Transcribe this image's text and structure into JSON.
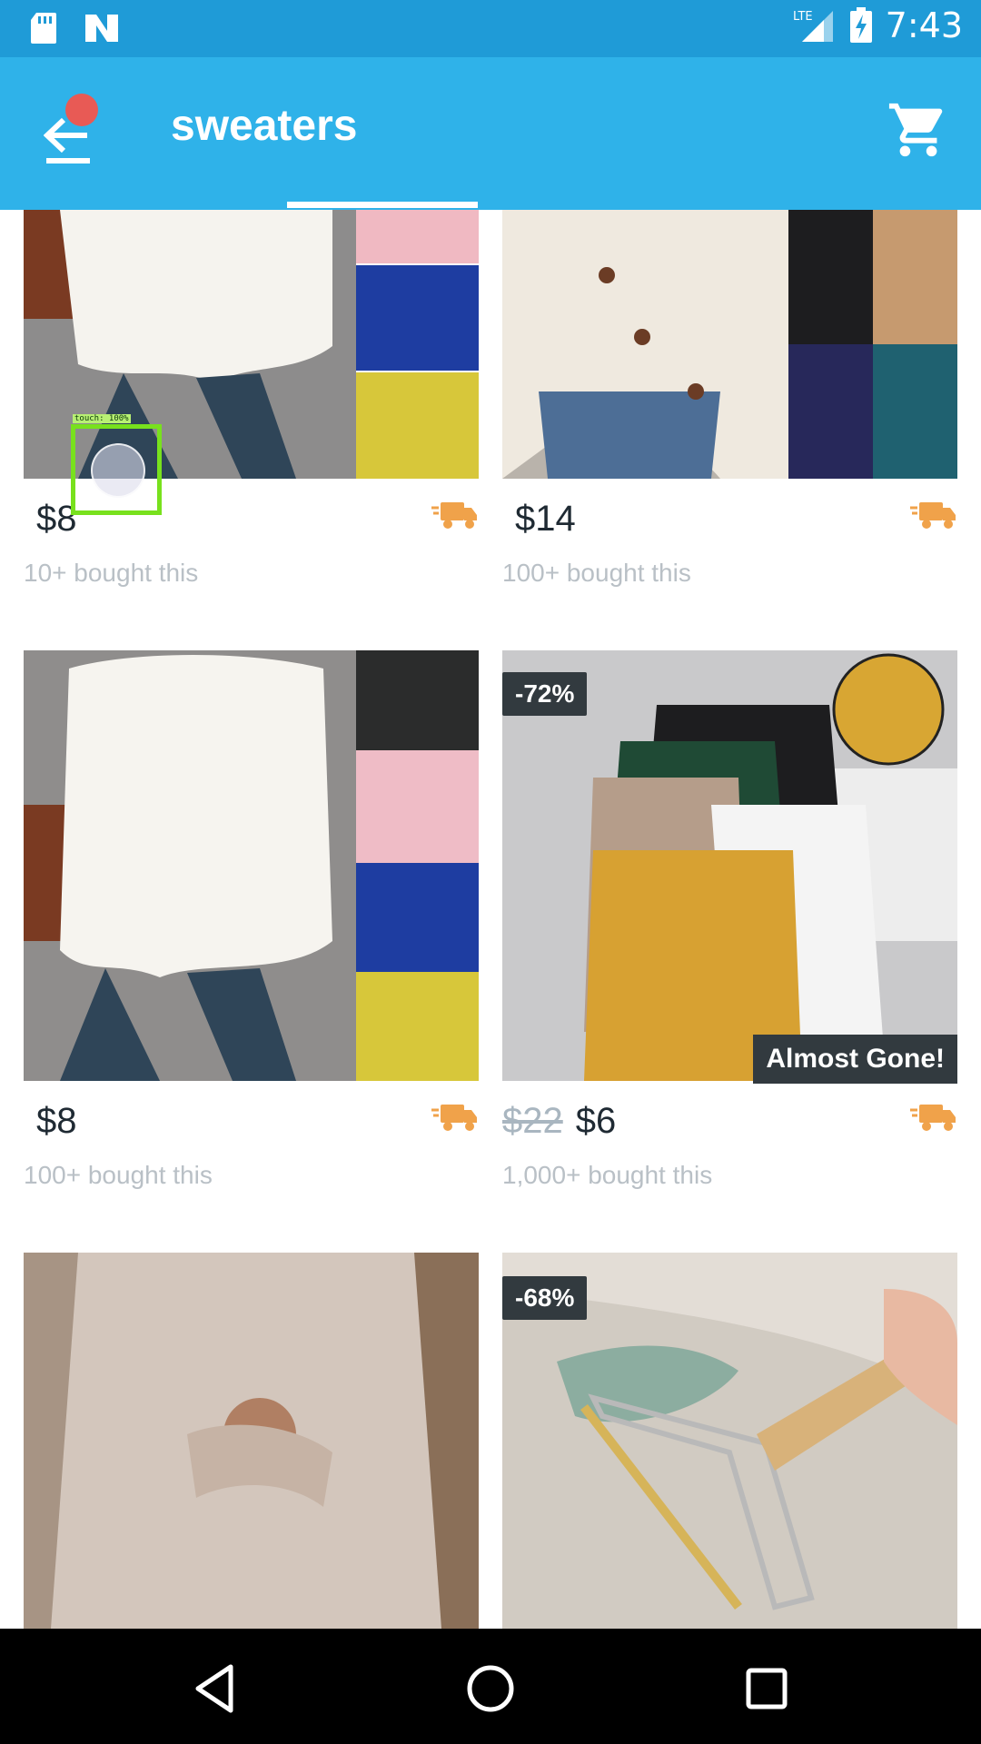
{
  "status_bar": {
    "left_icons": [
      "sd-card-icon",
      "n-logo-icon"
    ],
    "network": "LTE",
    "time": "7:43"
  },
  "app_bar": {
    "title": "sweaters",
    "back_icon": "back-arrow-icon",
    "cart_icon": "cart-icon"
  },
  "products": [
    {
      "old_price": "",
      "price": "$8",
      "bought": "10+ bought this",
      "badge": "",
      "tag": "",
      "image": "white-knit-sweater-with-color-swatches"
    },
    {
      "old_price": "",
      "price": "$14",
      "bought": "100+ bought this",
      "badge": "",
      "tag": "",
      "image": "cream-button-cardigan-with-color-swatches"
    },
    {
      "old_price": "",
      "price": "$8",
      "bought": "100+ bought this",
      "badge": "",
      "tag": "",
      "image": "white-batwing-sweater-with-color-swatches"
    },
    {
      "old_price": "$22",
      "price": "$6",
      "bought": "1,000+ bought this",
      "badge": "-72%",
      "tag": "Almost Gone!",
      "image": "ribbed-button-turtleneck-tops"
    },
    {
      "old_price": "",
      "price": "",
      "bought": "",
      "badge": "",
      "tag": "",
      "image": "beige-chunky-knit-sweater"
    },
    {
      "old_price": "",
      "price": "",
      "bought": "",
      "badge": "-68%",
      "tag": "",
      "image": "fabric-lint-remover-tool"
    }
  ],
  "touch_overlay": {
    "label": "touch: 100%"
  },
  "colors": {
    "status_bar": "#1f9bd7",
    "app_bar": "#2fb2e9",
    "shipping_icon": "#f0a24a",
    "badge": "#323a3f",
    "touch_box": "#78e11d"
  },
  "nav_bar": [
    "back-triangle-icon",
    "home-circle-icon",
    "recents-square-icon"
  ]
}
